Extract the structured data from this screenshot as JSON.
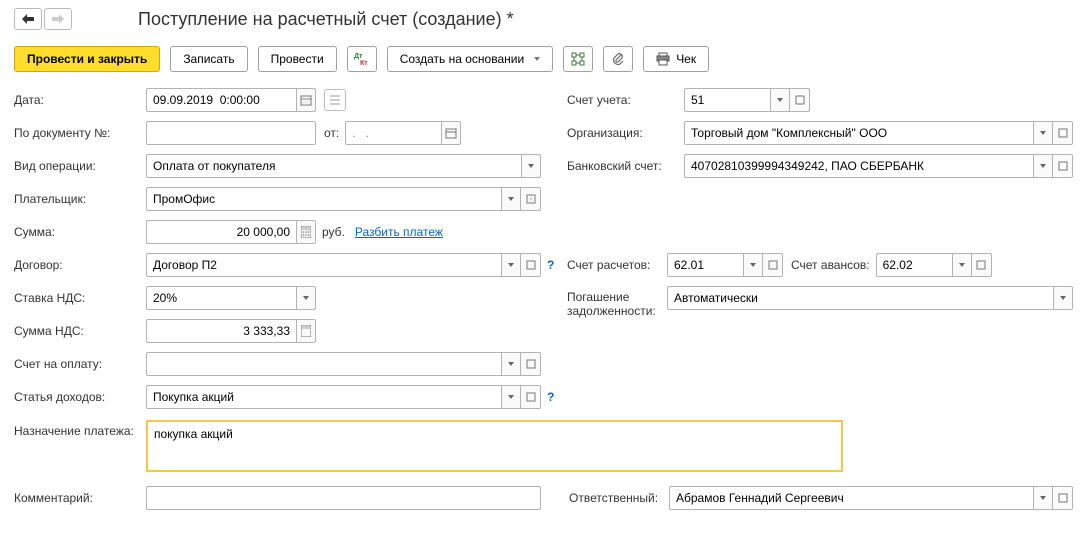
{
  "title": "Поступление на расчетный счет (создание) *",
  "toolbar": {
    "post_close": "Провести и закрыть",
    "write": "Записать",
    "post": "Провести",
    "create_based": "Создать на основании",
    "cheque": "Чек"
  },
  "left": {
    "date_label": "Дата:",
    "date_value": "09.09.2019  0:00:00",
    "docnum_label": "По документу №:",
    "ot_label": "от:",
    "date2_placeholder": ".   .",
    "optype_label": "Вид операции:",
    "optype_value": "Оплата от покупателя",
    "payer_label": "Плательщик:",
    "payer_value": "ПромОфис",
    "sum_label": "Сумма:",
    "sum_value": "20 000,00",
    "sum_currency": "руб.",
    "split_link": "Разбить платеж",
    "contract_label": "Договор:",
    "contract_value": "Договор П2",
    "vat_rate_label": "Ставка НДС:",
    "vat_rate_value": "20%",
    "vat_sum_label": "Сумма НДС:",
    "vat_sum_value": "3 333,33",
    "invoice_label": "Счет на оплату:",
    "income_item_label": "Статья доходов:",
    "income_item_value": "Покупка акций",
    "purpose_label": "Назначение платежа:",
    "purpose_value": "покупка акций",
    "comment_label": "Комментарий:"
  },
  "right": {
    "account_label": "Счет учета:",
    "account_value": "51",
    "org_label": "Организация:",
    "org_value": "Торговый дом \"Комплексный\" ООО",
    "bank_label": "Банковский счет:",
    "bank_value": "40702810399994349242, ПАО СБЕРБАНК",
    "settle_label": "Счет расчетов:",
    "settle_value": "62.01",
    "advance_label": "Счет авансов:",
    "advance_value": "62.02",
    "debt_label": "Погашение задолженности:",
    "debt_value": "Автоматически",
    "responsible_label": "Ответственный:",
    "responsible_value": "Абрамов Геннадий Сергеевич"
  }
}
